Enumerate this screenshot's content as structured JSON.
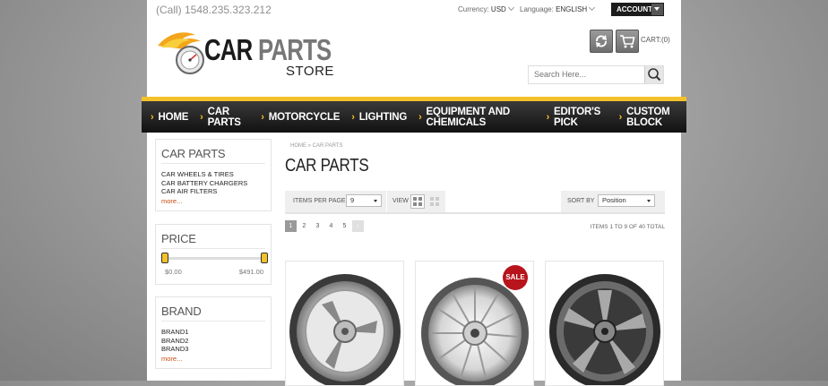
{
  "topbar": {
    "phone": "(Call) 1548.235.323.212",
    "currency_label": "Currency:",
    "currency_value": "USD",
    "language_label": "Language:",
    "language_value": "ENGLISH",
    "account_label": "ACCOUNT"
  },
  "logo": {
    "word1": "CAR",
    "word2": "PARTS",
    "word3": "STORE"
  },
  "header": {
    "cart_label": "CART:(0)",
    "search_placeholder": "Search Here..."
  },
  "nav": {
    "items": [
      {
        "label": "HOME"
      },
      {
        "label": "CAR PARTS"
      },
      {
        "label": "MOTORCYCLE"
      },
      {
        "label": "LIGHTING"
      },
      {
        "label": "EQUIPMENT AND CHEMICALS"
      },
      {
        "label": "EDITOR'S PICK"
      },
      {
        "label": "CUSTOM BLOCK"
      }
    ]
  },
  "sidebar": {
    "categories": {
      "title": "CAR PARTS",
      "items": [
        "CAR WHEELS & TIRES",
        "CAR BATTERY CHARGERS",
        "CAR AIR FILTERS"
      ],
      "more": "more..."
    },
    "price": {
      "title": "PRICE",
      "min": "$0.00",
      "max": "$491.00"
    },
    "brand": {
      "title": "BRAND",
      "items": [
        "BRAND1",
        "BRAND2",
        "BRAND3"
      ],
      "more": "more..."
    }
  },
  "main": {
    "breadcrumb": "HOME » CAR PARTS",
    "title": "CAR PARTS",
    "toolbar": {
      "items_per_page_label": "ITEMS PER PAGE",
      "items_per_page_value": "9",
      "view_label": "VIEW",
      "sort_label": "SORT BY",
      "sort_value": "Position"
    },
    "pager": {
      "pages": [
        "1",
        "2",
        "3",
        "4",
        "5"
      ],
      "next": "›",
      "summary": "ITEMS 1 TO 9 OF 40 TOTAL"
    },
    "products": [
      {
        "badge": ""
      },
      {
        "badge": "SALE"
      },
      {
        "badge": ""
      }
    ]
  },
  "colors": {
    "accent_yellow": "#f4c12a",
    "nav_dark": "#1a1a1a",
    "sale_red": "#b8141c",
    "link_orange": "#c64b14"
  }
}
